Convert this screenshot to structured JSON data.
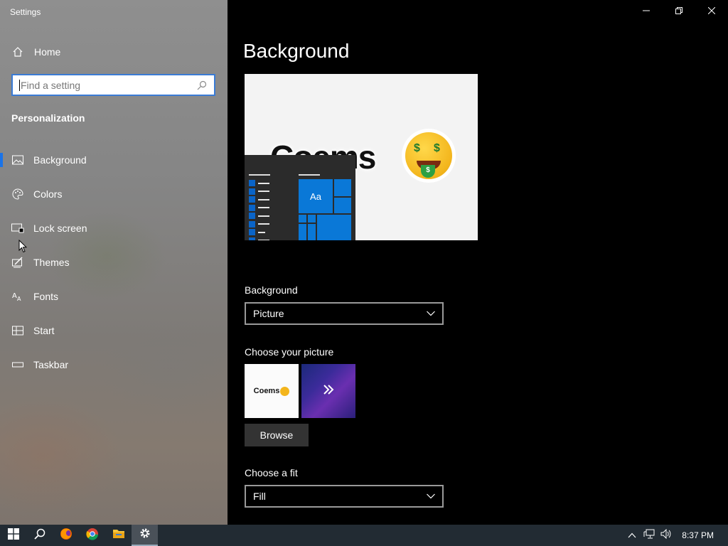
{
  "window": {
    "app_title": "Settings",
    "controls": {
      "minimize": "minimize-icon",
      "restore": "restore-icon",
      "close": "close-icon"
    }
  },
  "sidebar": {
    "home_label": "Home",
    "search": {
      "placeholder": "Find a setting"
    },
    "section_title": "Personalization",
    "items": [
      {
        "label": "Background",
        "icon": "picture-icon",
        "active": true
      },
      {
        "label": "Colors",
        "icon": "palette-icon",
        "active": false
      },
      {
        "label": "Lock screen",
        "icon": "lock-screen-icon",
        "active": false
      },
      {
        "label": "Themes",
        "icon": "themes-icon",
        "active": false
      },
      {
        "label": "Fonts",
        "icon": "fonts-icon",
        "active": false
      },
      {
        "label": "Start",
        "icon": "start-icon",
        "active": false
      },
      {
        "label": "Taskbar",
        "icon": "taskbar-icon",
        "active": false
      }
    ]
  },
  "main": {
    "title": "Background",
    "preview": {
      "wallpaper_text": "Coems",
      "tile_label": "Aa"
    },
    "background_section": {
      "label": "Background",
      "value": "Picture"
    },
    "choose_picture": {
      "label": "Choose your picture",
      "thumb1_text": "Coems"
    },
    "browse_label": "Browse",
    "fit_section": {
      "label": "Choose a fit",
      "value": "Fill"
    }
  },
  "taskbar": {
    "apps": [
      "start-icon",
      "search-icon",
      "firefox-icon",
      "chrome-icon",
      "file-explorer-icon",
      "settings-icon"
    ],
    "clock": "8:37 PM"
  },
  "colors": {
    "accent": "#1a73e8",
    "tile_blue": "#0a78d7",
    "taskbar": "#222b33"
  }
}
